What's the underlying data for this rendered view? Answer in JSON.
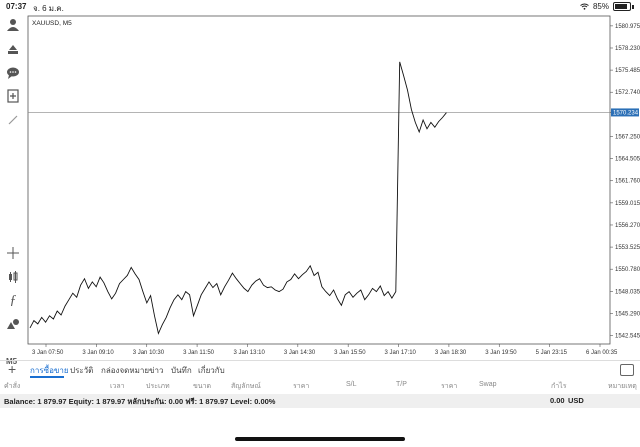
{
  "status": {
    "time": "07:37",
    "date": "จ. 6 ม.ค.",
    "battery": "85%",
    "battery_level": 0.85
  },
  "chart": {
    "symbol_label": "XAUUSD, M5",
    "current_price": "1570.234",
    "timeframe": "M5"
  },
  "chart_data": {
    "type": "line",
    "y_ticks": [
      "1580.975",
      "1578.230",
      "1575.485",
      "1572.740",
      "1570.234",
      "1567.250",
      "1564.505",
      "1561.760",
      "1559.015",
      "1556.270",
      "1553.525",
      "1550.780",
      "1548.035",
      "1545.290",
      "1542.545"
    ],
    "x_ticks": [
      "3 Jan 07:50",
      "3 Jan 09:10",
      "3 Jan 10:30",
      "3 Jan 11:50",
      "3 Jan 13:10",
      "3 Jan 14:30",
      "3 Jan 15:50",
      "3 Jan 17:10",
      "3 Jan 18:30",
      "3 Jan 19:50",
      "5 Jan 23:15",
      "6 Jan 00:35"
    ],
    "ylim": [
      1541.5,
      1582.2
    ],
    "x": [
      0,
      2,
      4,
      6,
      8,
      10,
      12,
      14,
      16,
      18,
      20,
      22,
      24,
      26,
      28,
      30,
      32,
      34,
      36,
      38,
      40,
      42,
      44,
      46,
      48,
      50,
      52,
      54,
      56,
      58,
      60,
      62,
      64,
      66,
      68,
      70,
      72,
      74,
      76,
      78,
      80,
      82,
      84,
      86,
      88,
      90,
      92,
      94,
      96,
      98,
      100,
      102,
      104,
      106,
      108,
      110,
      112,
      114,
      116,
      118,
      120,
      122,
      124,
      126,
      128,
      130,
      132,
      134,
      136,
      138,
      140,
      142,
      144,
      146,
      148,
      150,
      152,
      154,
      156,
      158,
      160,
      162,
      164,
      166,
      168,
      170,
      172,
      174,
      176,
      178,
      180,
      182,
      184,
      186,
      188,
      190,
      192,
      194,
      196,
      198,
      200,
      202,
      204,
      206,
      208,
      210,
      212,
      214,
      216,
      218,
      220,
      222,
      224,
      226,
      228,
      230,
      232,
      234,
      236,
      238,
      240,
      242,
      244,
      246,
      248,
      250,
      252,
      254,
      256,
      258,
      260,
      262,
      264,
      266,
      268,
      270,
      272,
      274,
      276,
      278,
      280,
      282,
      284,
      286,
      288,
      290,
      292,
      294,
      296
    ],
    "values": [
      1543.5,
      1544.4,
      1544.0,
      1544.8,
      1544.2,
      1545.0,
      1544.6,
      1545.6,
      1545.1,
      1546.2,
      1547.0,
      1547.8,
      1547.3,
      1548.8,
      1549.6,
      1548.4,
      1549.2,
      1548.6,
      1549.8,
      1549.1,
      1548.0,
      1547.1,
      1547.8,
      1549.0,
      1549.5,
      1550.0,
      1551.0,
      1550.2,
      1549.5,
      1548.0,
      1546.6,
      1547.5,
      1545.0,
      1542.8,
      1543.9,
      1544.8,
      1546.0,
      1547.0,
      1547.6,
      1547.0,
      1548.0,
      1547.6,
      1545.0,
      1546.3,
      1547.6,
      1548.4,
      1549.2,
      1548.5,
      1549.0,
      1547.6,
      1548.6,
      1549.4,
      1550.3,
      1549.6,
      1549.0,
      1548.4,
      1548.0,
      1548.8,
      1549.3,
      1549.6,
      1548.8,
      1548.5,
      1548.6,
      1548.2,
      1548.0,
      1548.3,
      1549.2,
      1549.5,
      1550.2,
      1549.6,
      1550.1,
      1550.5,
      1551.2,
      1550.0,
      1550.4,
      1548.6,
      1548.0,
      1547.5,
      1548.2,
      1547.1,
      1546.3,
      1547.6,
      1548.0,
      1547.3,
      1547.8,
      1548.2,
      1547.0,
      1547.6,
      1548.4,
      1548.0,
      1548.7,
      1547.5,
      1548.0,
      1547.2,
      1548.0,
      1576.5,
      1574.8,
      1573.0,
      1570.6,
      1569.0,
      1567.8,
      1569.3,
      1568.2,
      1569.0,
      1568.4,
      1569.1,
      1569.6,
      1570.2
    ],
    "current_price": 1570.234
  },
  "toolbar": {
    "icons": [
      "person-icon",
      "trade-icon",
      "chat-icon",
      "new-order-icon",
      "drawing-icon",
      "crosshair-icon",
      "candle-icon",
      "function-icon",
      "objects-icon"
    ]
  },
  "tabs": {
    "items": [
      "การซื้อขาย",
      "ประวัติ",
      "กล่องจดหมาย",
      "ข่าว",
      "บันทึก",
      "เกี่ยวกับ"
    ]
  },
  "columns": [
    "คำสั่ง",
    "เวลา",
    "ประเภท",
    "ขนาด",
    "สัญลักษณ์",
    "ราคา",
    "S/L",
    "T/P",
    "ราคา",
    "Swap",
    "กำไร",
    "หมายเหตุ"
  ],
  "balance": {
    "summary": "Balance: 1 879.97 Equity: 1 879.97 หลักประกัน: 0.00 ฟรี: 1 879.97 Level: 0.00%",
    "profit": "0.00",
    "currency": "USD"
  }
}
